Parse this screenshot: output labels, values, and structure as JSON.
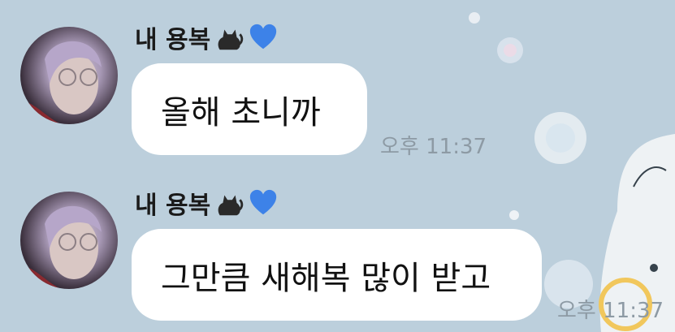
{
  "chat": {
    "messages": [
      {
        "sender": "내 용복",
        "text": "올해 초니까",
        "time": "오후 11:37"
      },
      {
        "sender": "내 용복",
        "text": "그만큼 새해복 많이 받고",
        "time": "오후 11:37"
      }
    ]
  },
  "colors": {
    "background": "#bccfdc",
    "bubble": "#ffffff",
    "timestamp": "#8d9aa4"
  },
  "icons": [
    "cat-emoji-icon",
    "blue-heart-emoji-icon",
    "avatar"
  ]
}
